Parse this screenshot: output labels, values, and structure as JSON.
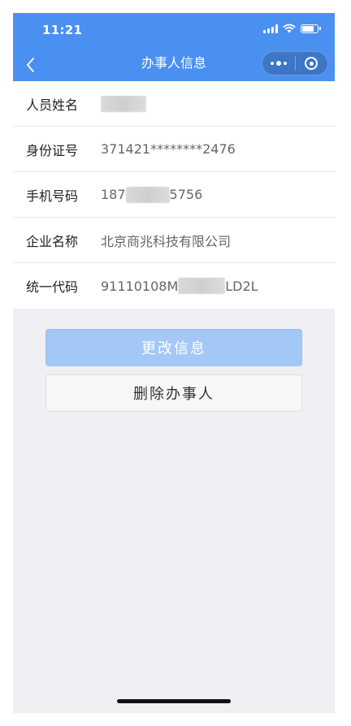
{
  "status_bar": {
    "time": "11:21",
    "icons": [
      "signal-icon",
      "wifi-icon",
      "battery-icon"
    ]
  },
  "nav": {
    "title": "办事人信息",
    "back_icon": "chevron-left-icon",
    "menu_icon": "more-dots-icon",
    "close_icon": "target-circle-icon"
  },
  "info": {
    "rows": [
      {
        "label": "人员姓名",
        "value_prefix": "",
        "value_suffix": "",
        "masked": true
      },
      {
        "label": "身份证号",
        "value_prefix": "371421********2476",
        "value_suffix": "",
        "masked": false
      },
      {
        "label": "手机号码",
        "value_prefix": "187",
        "value_suffix": "5756",
        "masked": true
      },
      {
        "label": "企业名称",
        "value_prefix": "北京商兆科技有限公司",
        "value_suffix": "",
        "masked": false
      },
      {
        "label": "统一代码",
        "value_prefix": "91110108M",
        "value_suffix": "LD2L",
        "masked": true
      }
    ]
  },
  "actions": {
    "edit_label": "更改信息",
    "delete_label": "删除办事人"
  },
  "colors": {
    "header": "#4a90f0",
    "primary_button": "#a3c8f6",
    "background": "#efeff4"
  }
}
